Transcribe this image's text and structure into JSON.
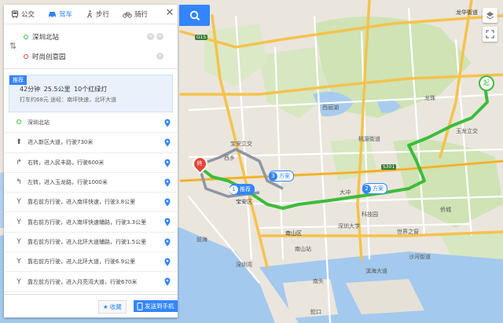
{
  "modes": [
    {
      "label": "公交",
      "icon": "bus-icon"
    },
    {
      "label": "驾车",
      "icon": "car-icon",
      "active": true
    },
    {
      "label": "步行",
      "icon": "walk-icon"
    },
    {
      "label": "骑行",
      "icon": "bike-icon"
    }
  ],
  "route": {
    "start": "深圳北站",
    "end": "时尚创意园"
  },
  "summary": {
    "badge": "推荐",
    "line1": "42分钟    25.5公里    10个红绿灯",
    "line2": "打车约68元    途经：南坪快速，北环大道"
  },
  "steps": [
    {
      "text": "深圳北站",
      "icon": "origin-dot-icon"
    },
    {
      "text": "进入新区大道，行驶730米",
      "icon": "straight-arrow-icon"
    },
    {
      "text": "右转，进入民丰路，行驶600米",
      "icon": "turn-right-icon"
    },
    {
      "text": "左转，进入玉龙路，行驶1000米",
      "icon": "turn-left-icon"
    },
    {
      "text": "靠右前方行驶，进入南坪快速，行驶3.8公里",
      "icon": "keep-right-icon"
    },
    {
      "text": "靠右前方行驶，进入南坪快速辅路，行驶3.3公里",
      "icon": "keep-right-icon"
    },
    {
      "text": "靠右前方行驶，进入北环大道辅路，行驶1.5公里",
      "icon": "keep-right-icon"
    },
    {
      "text": "靠右前方行驶，进入北环大道，行驶6.9公里",
      "icon": "keep-right-icon"
    },
    {
      "text": "靠左前方行驶，进入月亮湾大道，行驶670米",
      "icon": "keep-left-icon"
    }
  ],
  "footer": {
    "favorite": "收藏",
    "send": "发送到手机"
  },
  "map": {
    "labels": {
      "longhua_jiedao": "龙华街道",
      "bao_an_li": "宝安立交",
      "xi_xiang": "西乡",
      "bao_an_qu": "宝安区",
      "nan_shan_qu": "南山区",
      "keji_yuan": "科技园",
      "shenzhen_daxue": "深圳大学",
      "taoyuan": "桃源街道",
      "xili_hu": "西丽湖",
      "nanshan_zhan": "南山站",
      "shekou": "蛇口",
      "nantou": "南头",
      "yuelong": "玉龙立交",
      "shahe": "沙河街道",
      "qiaocheng": "侨城",
      "wanshiwu": "世界之窗",
      "binhai": "滨海大道",
      "shenzhen_wan": "深圳湾",
      "longzhu": "龙珠",
      "g15": "G15",
      "s301": "S301",
      "qianhai": "前海",
      "dachong": "大冲"
    },
    "plans": [
      {
        "num": "1",
        "label": "推荐"
      },
      {
        "num": "2",
        "label": "方案"
      },
      {
        "num": "3",
        "label": "方案"
      }
    ],
    "start_marker": "起",
    "end_marker": "终"
  },
  "colors": {
    "accent": "#3385ff",
    "route": "#3dbc3d",
    "alt_route": "#8f96a3"
  }
}
